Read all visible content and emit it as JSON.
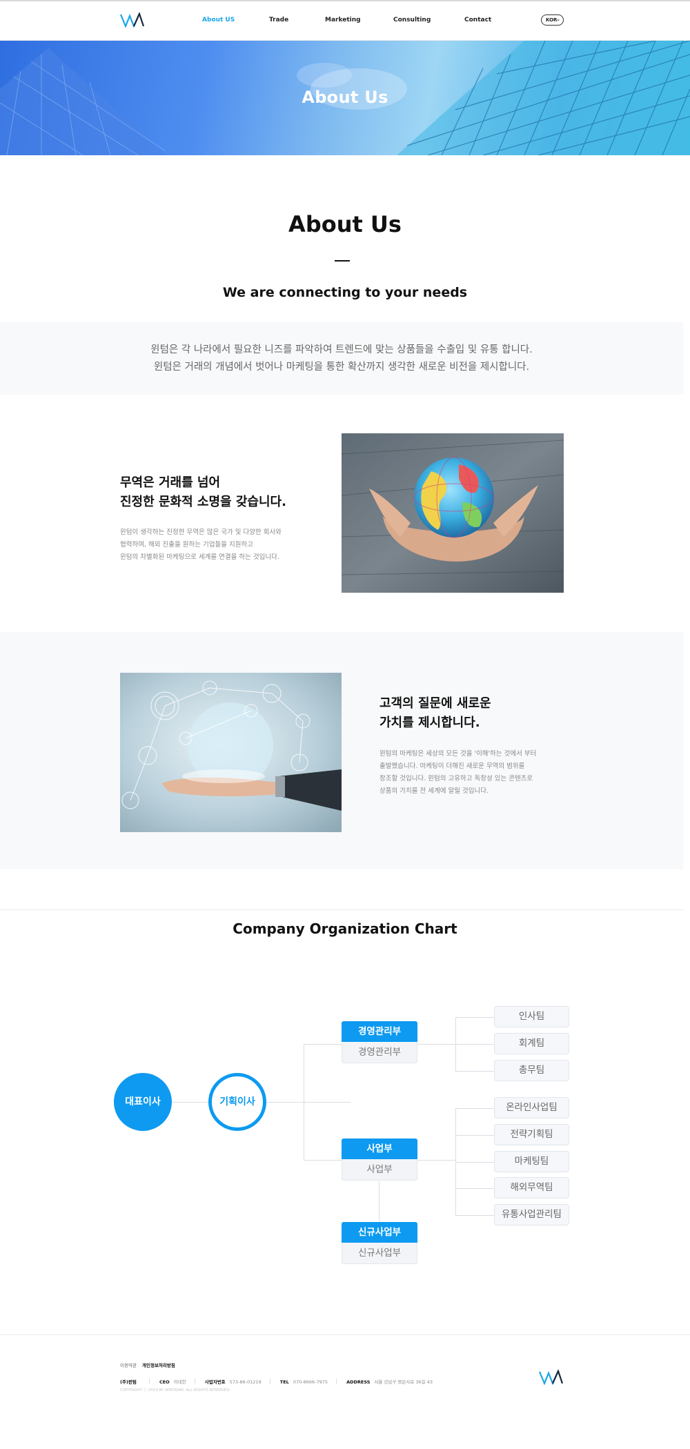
{
  "nav": {
    "items": [
      "About US",
      "Trade",
      "Marketing",
      "Consulting",
      "Contact"
    ],
    "active": "About US",
    "lang": "KOR"
  },
  "hero": {
    "title": "About Us"
  },
  "about": {
    "title": "About Us",
    "subtitle": "We are connecting to your needs",
    "intro": [
      "윈텀은 각 나라에서 필요한 니즈를 파악하여 트렌드에 맞는 상품들을 수출입 및 유통 합니다.",
      "윈텀은 거래의 개념에서 벗어나 마케팅을 통한 확산까지 생각한 새로운 비전을 제시합니다."
    ]
  },
  "block1": {
    "title": [
      "무역은 거래를 넘어",
      "진정한 문화적 소명을 갖습니다."
    ],
    "text": [
      "윈텀이 생각하는 진정한 무역은 많은 국가 및 다양한 회사와",
      "협력하며, 해외 진출을 원하는 기업들을 지원하고",
      "윈텀의 차별화된 마케팅으로 세계를 연결을 하는 것입니다."
    ]
  },
  "block2": {
    "title": [
      "고객의 질문에 새로운",
      "가치를 제시합니다."
    ],
    "text": [
      "윈텀의 마케팅은 세상의 모든 것을 '이해'하는 것에서 부터",
      "출발했습니다. 마케팅이 더해진 새로운 무역의 범위를",
      "창조할 것입니다. 윈텀의 고유하고 독창성 있는 콘텐츠로",
      "상품의 가치를 전 세계에 알릴 것입니다."
    ]
  },
  "org": {
    "title": "Company Organization Chart",
    "ceo": "대표이사",
    "director": "기획이사",
    "departments": [
      {
        "name": "경영관리부",
        "sub": "경영관리부",
        "teams": [
          "인사팀",
          "회계팀",
          "총무팀"
        ]
      },
      {
        "name": "사업부",
        "sub": "사업부",
        "teams": [
          "온라인사업팀",
          "전략기획팀",
          "마케팅팀",
          "해외무역팀",
          "유통사업관리팀"
        ]
      },
      {
        "name": "신규사업부",
        "sub": "신규사업부",
        "teams": []
      }
    ]
  },
  "footer": {
    "links": [
      "이용약관",
      "개인정보처리방침"
    ],
    "info": [
      {
        "key": "(주)윈텀",
        "value": ""
      },
      {
        "key": "CEO",
        "value": "이대한"
      },
      {
        "key": "사업자번호",
        "value": "573-86-01219"
      },
      {
        "key": "TEL",
        "value": "070-8666-7975"
      },
      {
        "key": "ADDRESS",
        "value": "서울 강남구 봉은사로 36길 43"
      }
    ],
    "copyright": "COPYRIGHT ⓒ 2019 BY WINTEAM. ALL RIGHTS RESERVED."
  },
  "colors": {
    "accent": "#0d9af0",
    "nav_active": "#1aa6e8",
    "band": "#f8f9fb"
  }
}
